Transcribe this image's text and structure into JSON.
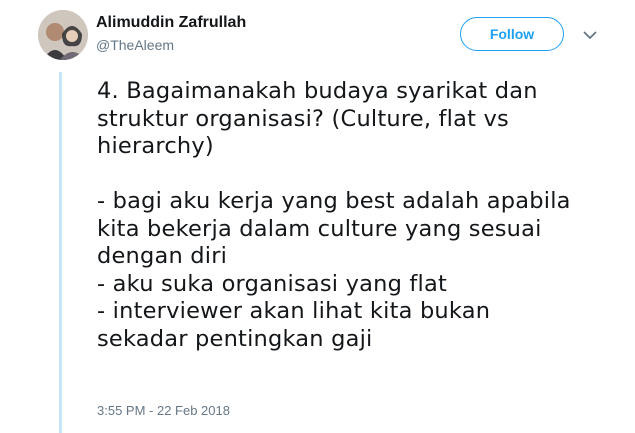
{
  "user": {
    "name": "Alimuddin Zafrullah",
    "handle": "@TheAleem"
  },
  "follow_button": {
    "label": "Follow"
  },
  "menu": {
    "icon": "chevron-down-icon"
  },
  "tweet": {
    "text": "4. Bagaimanakah budaya syarikat dan\nstruktur organisasi? (Culture, flat vs\nhierarchy)\n\n- bagi aku kerja yang best adalah apabila\nkita bekerja dalam culture yang sesuai\ndengan diri\n- aku suka organisasi yang flat\n- interviewer akan lihat kita bukan\nsekadar pentingkan gaji",
    "timestamp": "3:55 PM - 22 Feb 2018"
  },
  "colors": {
    "accent": "#1da1f2",
    "thread_line": "#c4e4f9",
    "text": "#14171a",
    "muted": "#657786"
  }
}
